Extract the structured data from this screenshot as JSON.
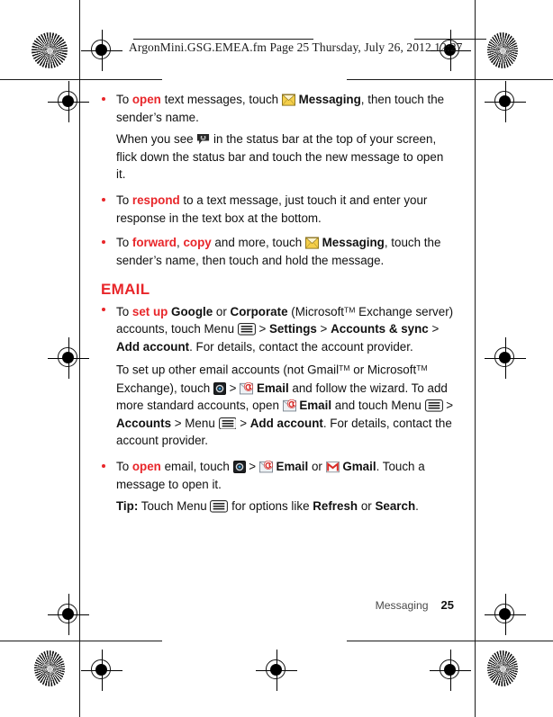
{
  "page": {
    "slug": "ArgonMini.GSG.EMEA.fm  Page 25  Thursday, July 26, 2012  12:27",
    "accent_red": "#e8262a",
    "footer": {
      "section_name": "Messaging",
      "page_number": "25"
    }
  },
  "messaging": {
    "b1": {
      "p1_a": "To ",
      "p1_open": "open",
      "p1_b": " text messages, touch ",
      "p1_icon": "messaging-envelope-icon",
      "p1_app": "Messaging",
      "p1_c": ", then touch the sender’s name."
    },
    "b1_para": {
      "a": "When you see ",
      "icon": "message-bubble-status-icon",
      "b": " in the status bar at the top of your screen, flick down the status bar and touch the new message to open it."
    },
    "b2": {
      "a": "To ",
      "respond": "respond",
      "b": " to a text message, just touch it and enter your response in the text box at the bottom."
    },
    "b3": {
      "a": "To ",
      "forward": "forward",
      "comma": ", ",
      "copy": "copy",
      "b": " and more, touch ",
      "icon": "messaging-envelope-icon",
      "app": "Messaging",
      "c": ", touch the sender’s name, then touch and hold the message."
    }
  },
  "email": {
    "heading": "EMAIL",
    "b1": {
      "a": "To ",
      "setup": "set up",
      "b": " ",
      "google": "Google",
      "c": " or ",
      "corporate": "Corporate",
      "d": " (Microsoft",
      "tm1": "TM",
      "e": " Exchange server) accounts, touch Menu ",
      "menu_icon": "menu-key-icon",
      "f": " > ",
      "settings": "Settings",
      "g": " > ",
      "accounts_sync": "Accounts & sync",
      "h": " > ",
      "add_account": "Add account",
      "i": ". For details, contact the account provider."
    },
    "b1_para": {
      "a": "To set up other email accounts (not Gmail",
      "tm1": "TM",
      "b": " or Microsoft",
      "tm2": "TM",
      "c": " Exchange), touch ",
      "launcher_icon": "app-launcher-icon",
      "d": " > ",
      "email_icon": "email-app-icon",
      "email": "Email",
      "e": " and follow the wizard. To add more standard accounts, open ",
      "email_icon2": "email-app-icon",
      "email2": "Email",
      "f": " and touch Menu ",
      "menu_icon": "menu-key-icon",
      "g": " > ",
      "accounts": "Accounts",
      "h": " > Menu ",
      "menu_icon2": "menu-key-icon",
      "i": " > ",
      "add_account": "Add account",
      "j": ". For details, contact the account provider."
    },
    "b2": {
      "a": "To ",
      "open": "open",
      "b": " email, touch ",
      "launcher_icon": "app-launcher-icon",
      "c": " > ",
      "email_icon": "email-app-icon",
      "email": "Email",
      "d": " or ",
      "gmail_icon": "gmail-app-icon",
      "gmail": "Gmail",
      "e": ". Touch a message to open it."
    },
    "tip": {
      "label": "Tip:",
      "a": " Touch Menu ",
      "menu_icon": "menu-key-icon",
      "b": " for options like ",
      "refresh": "Refresh",
      "c": " or ",
      "search": "Search",
      "d": "."
    }
  }
}
